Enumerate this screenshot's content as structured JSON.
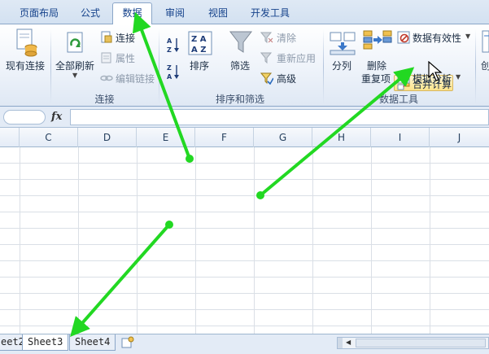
{
  "tabs": [
    "页面布局",
    "公式",
    "数据",
    "审阅",
    "视图",
    "开发工具"
  ],
  "ribbon": {
    "existing_connection": "现有连接",
    "refresh_all": "全部刷新",
    "connections": "连接",
    "properties": "属性",
    "edit_links": "编辑链接",
    "group_connections": "连接",
    "sort_label": "排序",
    "filter_label": "筛选",
    "clear_label": "清除",
    "reapply_label": "重新应用",
    "advanced_label": "高级",
    "group_sort_filter": "排序和筛选",
    "split_label": "分列",
    "delete_label": "删除",
    "duplicates_label": "重复项",
    "data_validation": "数据有效性",
    "consolidate": "合并计算",
    "what_if": "模拟分析",
    "group_data_tools": "数据工具",
    "create_label": "创"
  },
  "formula_bar": {
    "fx_label": "fx",
    "value": ""
  },
  "columns": [
    "C",
    "D",
    "E",
    "F",
    "G",
    "H",
    "I",
    "J"
  ],
  "sheets": [
    "eet2",
    "Sheet3",
    "Sheet4"
  ],
  "colors": {
    "arrow": "#22d822",
    "tab_text": "#15428b",
    "highlight": "#ffe48a"
  }
}
